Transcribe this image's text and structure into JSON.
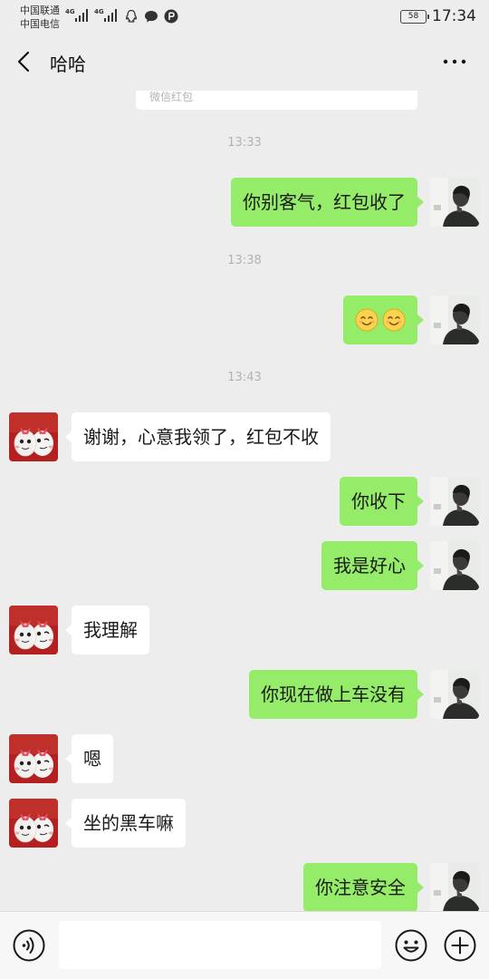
{
  "status_bar": {
    "carrier1": "中国联通",
    "carrier2": "中国电信",
    "network1": "4G",
    "network2": "4G",
    "battery": "58",
    "time": "17:34",
    "icons": [
      "qq-icon",
      "chat-bubble-icon",
      "parking-icon"
    ]
  },
  "header": {
    "title": "哈哈",
    "back_icon": "chevron-left-icon",
    "more_icon": "more-dots-icon"
  },
  "chat": {
    "red_packet_label": "微信红包",
    "times": [
      "13:33",
      "13:38",
      "13:43"
    ],
    "messages": [
      {
        "from": "me",
        "text": "你别客气，红包收了"
      },
      {
        "from": "me",
        "text": "",
        "emojis": [
          "smile-emoji",
          "smile-emoji"
        ]
      },
      {
        "from": "friend",
        "text": "谢谢，心意我领了，红包不收"
      },
      {
        "from": "me",
        "text": "你收下"
      },
      {
        "from": "me",
        "text": "我是好心"
      },
      {
        "from": "friend",
        "text": "我理解"
      },
      {
        "from": "me",
        "text": "你现在做上车没有"
      },
      {
        "from": "friend",
        "text": "嗯"
      },
      {
        "from": "friend",
        "text": "坐的黑车嘛"
      },
      {
        "from": "me",
        "text": "你注意安全"
      }
    ]
  },
  "input_bar": {
    "value": "",
    "voice_icon": "voice-icon",
    "emoji_icon": "emoji-icon",
    "plus_icon": "plus-icon"
  },
  "colors": {
    "background": "#ededed",
    "my_bubble": "#95ec69",
    "friend_bubble": "#ffffff",
    "timestamp": "#b2b2b2"
  }
}
